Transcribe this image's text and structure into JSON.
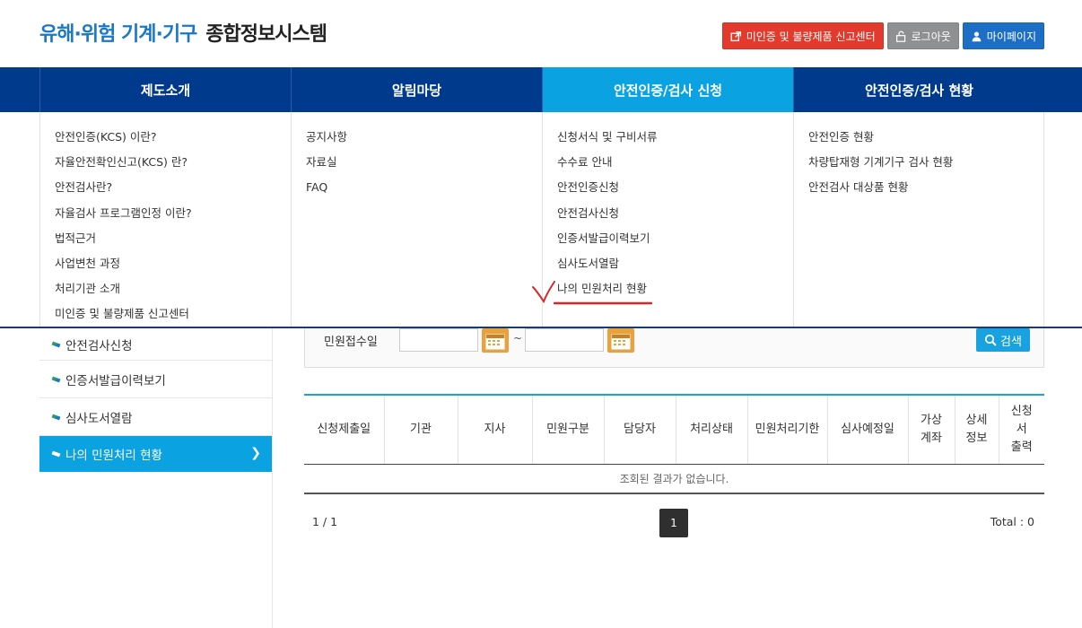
{
  "header": {
    "logo_blue": "유해·위험 기계·기구",
    "logo_dark": "종합정보시스템",
    "buttons": {
      "report": "미인증 및 불량제품 신고센터",
      "logout": "로그아웃",
      "mypage": "마이페이지"
    }
  },
  "gnb": [
    {
      "label": "제도소개"
    },
    {
      "label": "알림마당"
    },
    {
      "label": "안전인증/검사 신청"
    },
    {
      "label": "안전인증/검사 현황"
    }
  ],
  "mega": {
    "col1": [
      "안전인증(KCS) 이란?",
      "자율안전확인신고(KCS) 란?",
      "안전검사란?",
      "자율검사 프로그램인정 이란?",
      "법적근거",
      "사업변천 과정",
      "처리기관 소개",
      "미인증 및 불량제품 신고센터"
    ],
    "col2": [
      "공지사항",
      "자료실",
      "FAQ"
    ],
    "col3": [
      "신청서식 및 구비서류",
      "수수료 안내",
      "안전인증신청",
      "안전검사신청",
      "인증서발급이력보기",
      "심사도서열람",
      "나의 민원처리 현황"
    ],
    "col4": [
      "안전인증 현황",
      "차량탑재형 기계기구 검사 현황",
      "안전검사 대상품 현황"
    ]
  },
  "sidebar": [
    {
      "label": "안전검사신청"
    },
    {
      "label": "인증서발급이력보기"
    },
    {
      "label": "심사도서열람"
    },
    {
      "label": "나의 민원처리 현황"
    }
  ],
  "search": {
    "label": "민원접수일",
    "from_value": "",
    "to_value": "",
    "separator": "~",
    "button": "검색"
  },
  "table": {
    "headers": [
      "신청제출일",
      "기관",
      "지사",
      "민원구분",
      "담당자",
      "처리상태",
      "민원처리기한",
      "심사예정일",
      "가상\n계좌",
      "상세\n정보",
      "신청\n서\n출력"
    ],
    "empty_message": "조회된 결과가 없습니다."
  },
  "pagination": {
    "page_info": "1 / 1",
    "current_page": "1",
    "total": "Total : 0"
  },
  "colors": {
    "nav_bg": "#003a8c",
    "accent": "#0aa2e0",
    "report_btn": "#e23b2e",
    "calendar": "#e9a23b"
  }
}
